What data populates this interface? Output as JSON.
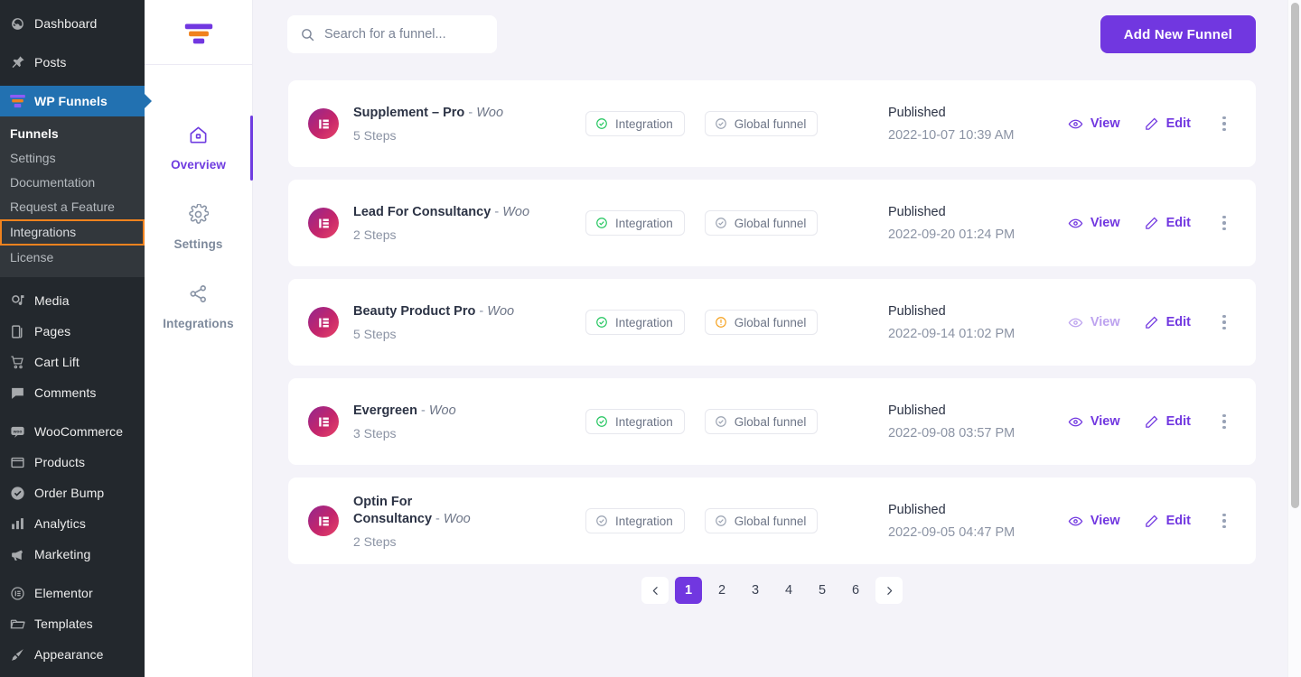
{
  "wp_sidebar": {
    "items": [
      {
        "label": "Dashboard",
        "icon": "dashboard-icon",
        "state": "normal"
      },
      {
        "label": "Posts",
        "icon": "pin-icon",
        "state": "normal"
      },
      {
        "label": "WP Funnels",
        "icon": "funnel-icon",
        "state": "active"
      }
    ],
    "submenu": [
      {
        "label": "Funnels",
        "state": "current"
      },
      {
        "label": "Settings",
        "state": "normal"
      },
      {
        "label": "Documentation",
        "state": "normal"
      },
      {
        "label": "Request a Feature",
        "state": "normal"
      },
      {
        "label": "Integrations",
        "state": "highlighted"
      },
      {
        "label": "License",
        "state": "normal"
      }
    ],
    "items_lower": [
      {
        "label": "Media",
        "icon": "media-icon"
      },
      {
        "label": "Pages",
        "icon": "pages-icon"
      },
      {
        "label": "Cart Lift",
        "icon": "cart-icon"
      },
      {
        "label": "Comments",
        "icon": "comment-icon"
      }
    ],
    "items_woo": [
      {
        "label": "WooCommerce",
        "icon": "woo-icon"
      },
      {
        "label": "Products",
        "icon": "products-icon"
      },
      {
        "label": "Order Bump",
        "icon": "check-circle-icon"
      },
      {
        "label": "Analytics",
        "icon": "bar-chart-icon"
      },
      {
        "label": "Marketing",
        "icon": "megaphone-icon"
      }
    ],
    "items_tools": [
      {
        "label": "Elementor",
        "icon": "elementor-icon"
      },
      {
        "label": "Templates",
        "icon": "folder-icon"
      },
      {
        "label": "Appearance",
        "icon": "brush-icon"
      }
    ],
    "highlight_color": "#f0821e",
    "active_color": "#2271b1"
  },
  "funnel_nav": {
    "logo_icon": "wp-funnels-logo",
    "items": [
      {
        "label": "Overview",
        "icon": "home-icon",
        "state": "active"
      },
      {
        "label": "Settings",
        "icon": "gear-icon",
        "state": "normal"
      },
      {
        "label": "Integrations",
        "icon": "share-nodes-icon",
        "state": "normal"
      }
    ],
    "accent_color": "#6f3ce0"
  },
  "toolbar": {
    "search_placeholder": "Search for a funnel...",
    "search_value": "",
    "search_icon": "search-icon",
    "add_button_label": "Add New Funnel",
    "add_button_color": "#7137e0"
  },
  "funnels": [
    {
      "name": "Supplement – Pro",
      "separator": "-",
      "platform": "Woo",
      "steps": "5 Steps",
      "integration_label": "Integration",
      "integration_state": "ok",
      "global_label": "Global funnel",
      "global_state": "neutral",
      "status": "Published",
      "date": "2022-10-07 10:39 AM",
      "view_label": "View",
      "view_state": "enabled",
      "edit_label": "Edit"
    },
    {
      "name": "Lead For Consultancy",
      "separator": "-",
      "platform": "Woo",
      "steps": "2 Steps",
      "integration_label": "Integration",
      "integration_state": "ok",
      "global_label": "Global funnel",
      "global_state": "neutral",
      "status": "Published",
      "date": "2022-09-20 01:24 PM",
      "view_label": "View",
      "view_state": "enabled",
      "edit_label": "Edit"
    },
    {
      "name": "Beauty Product Pro",
      "separator": "-",
      "platform": "Woo",
      "steps": "5 Steps",
      "integration_label": "Integration",
      "integration_state": "ok",
      "global_label": "Global funnel",
      "global_state": "warning",
      "status": "Published",
      "date": "2022-09-14 01:02 PM",
      "view_label": "View",
      "view_state": "faded",
      "edit_label": "Edit"
    },
    {
      "name": "Evergreen",
      "separator": "-",
      "platform": "Woo",
      "steps": "3 Steps",
      "integration_label": "Integration",
      "integration_state": "ok",
      "global_label": "Global funnel",
      "global_state": "neutral",
      "status": "Published",
      "date": "2022-09-08 03:57 PM",
      "view_label": "View",
      "view_state": "enabled",
      "edit_label": "Edit"
    },
    {
      "name": "Optin For Consultancy",
      "separator": "-",
      "platform": "Woo",
      "steps": "2 Steps",
      "integration_label": "Integration",
      "integration_state": "neutral",
      "global_label": "Global funnel",
      "global_state": "neutral",
      "status": "Published",
      "date": "2022-09-05 04:47 PM",
      "view_label": "View",
      "view_state": "enabled",
      "edit_label": "Edit"
    }
  ],
  "pagination": {
    "prev_icon": "chevron-left-icon",
    "next_icon": "chevron-right-icon",
    "pages": [
      "1",
      "2",
      "3",
      "4",
      "5",
      "6"
    ],
    "current": "1",
    "active_color": "#7137e0"
  }
}
